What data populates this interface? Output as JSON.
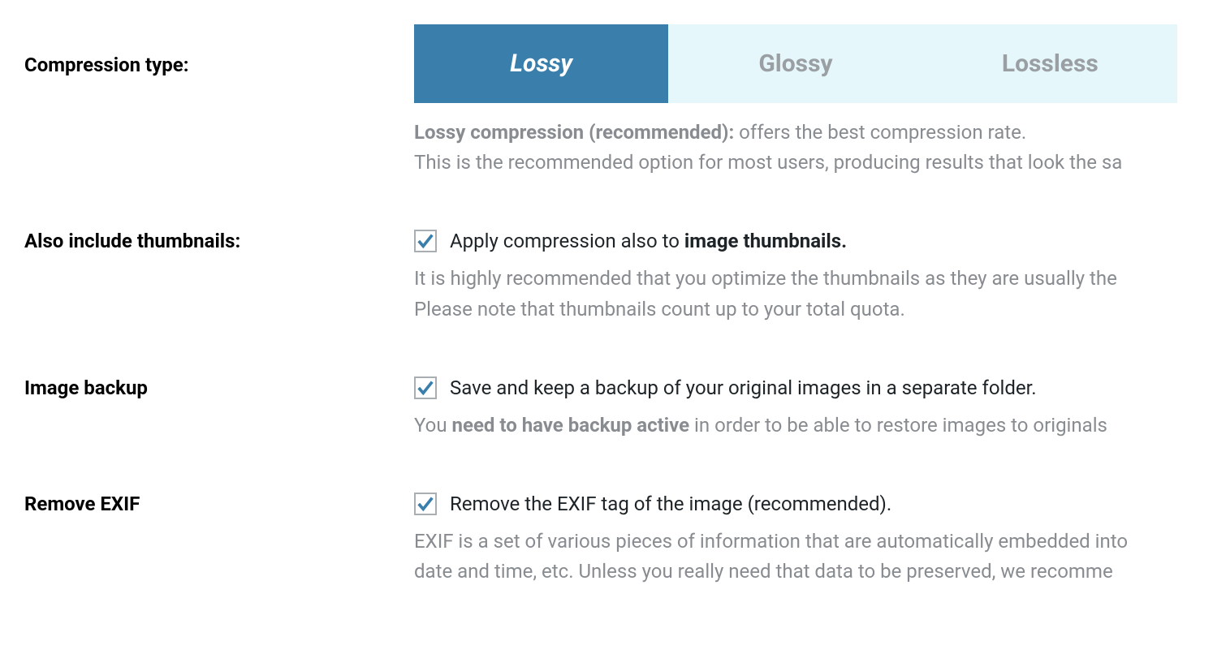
{
  "compression": {
    "label": "Compression type:",
    "options": {
      "lossy": "Lossy",
      "glossy": "Glossy",
      "lossless": "Lossless"
    },
    "selected": "lossy",
    "desc_bold": "Lossy compression (recommended):",
    "desc_rest": " offers the best compression rate.",
    "desc_line2": "This is the recommended option for most users, producing results that look the sa"
  },
  "thumbnails": {
    "label": "Also include thumbnails:",
    "checked": true,
    "chk_pre": "Apply compression also to ",
    "chk_bold": "image thumbnails.",
    "desc_line1": "It is highly recommended that you optimize the thumbnails as they are usually the",
    "desc_line2": "Please note that thumbnails count up to your total quota."
  },
  "backup": {
    "label": "Image backup",
    "checked": true,
    "chk_text": "Save and keep a backup of your original images in a separate folder.",
    "desc_pre": "You ",
    "desc_bold": "need to have backup active",
    "desc_post": " in order to be able to restore images to originals"
  },
  "exif": {
    "label": "Remove EXIF",
    "checked": true,
    "chk_text": "Remove the EXIF tag of the image (recommended).",
    "desc_line1": "EXIF is a set of various pieces of information that are automatically embedded into",
    "desc_line2": "date and time, etc. Unless you really need that data to be preserved, we recomme"
  }
}
